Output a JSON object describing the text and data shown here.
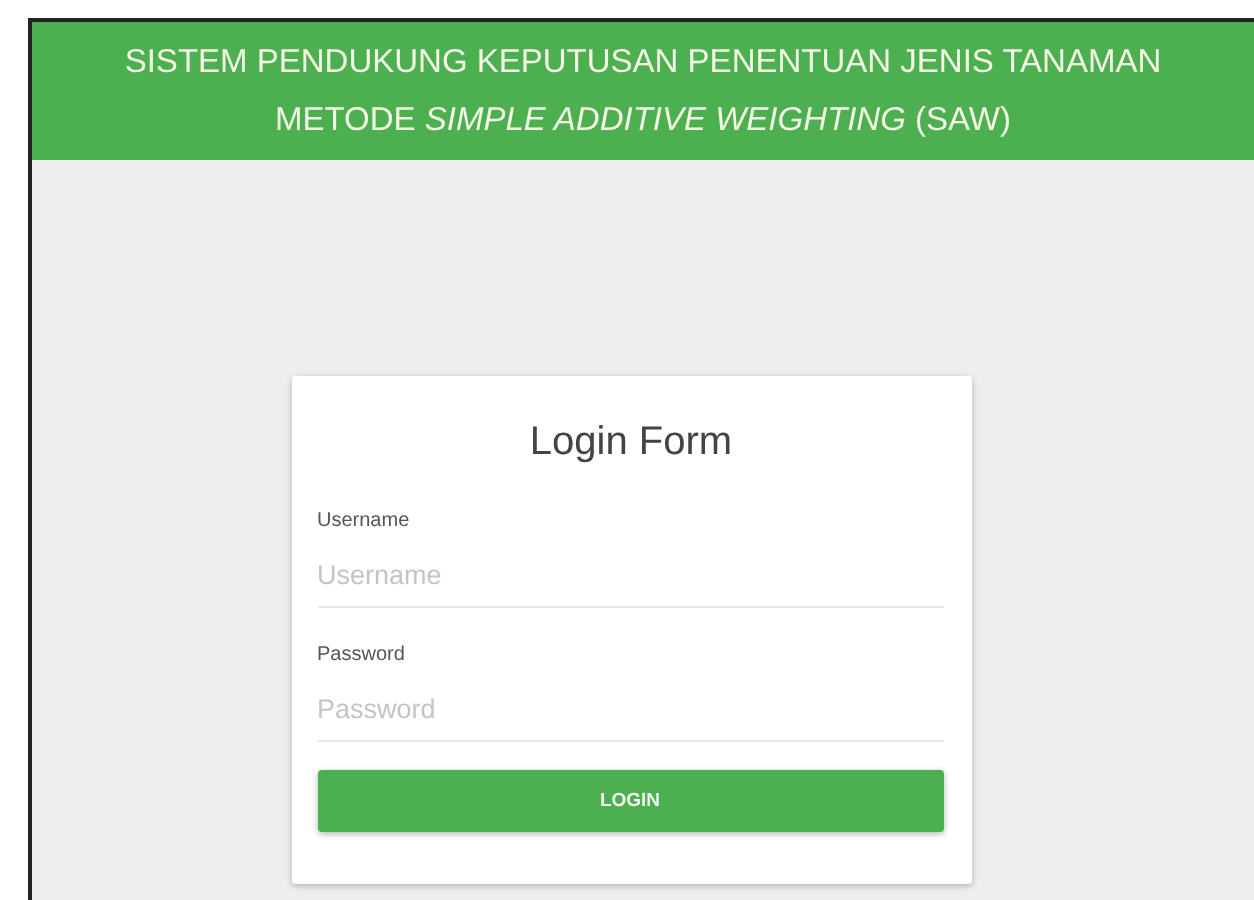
{
  "header": {
    "title": "SISTEM PENDUKUNG KEPUTUSAN PENENTUAN JENIS TANAMAN METODE *SIMPLE ADDITIVE WEIGHTING* (SAW)"
  },
  "login_form": {
    "title": "Login Form",
    "fields": [
      {
        "label": "Username",
        "placeholder": "Username"
      },
      {
        "label": "Password",
        "placeholder": "Password"
      }
    ],
    "button": "LOGIN"
  }
}
